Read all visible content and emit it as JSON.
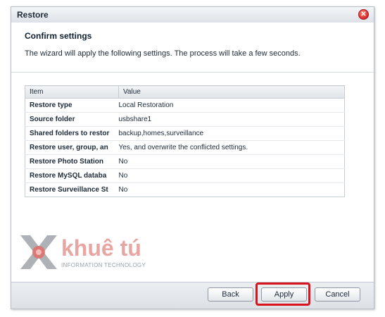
{
  "window": {
    "title": "Restore",
    "close_label": "✕"
  },
  "header": {
    "heading": "Confirm settings",
    "description": "The wizard will apply the following settings. The process will take a few seconds."
  },
  "table": {
    "columns": [
      "Item",
      "Value"
    ],
    "rows": [
      {
        "item": "Restore type",
        "value": "Local Restoration"
      },
      {
        "item": "Source folder",
        "value": "usbshare1"
      },
      {
        "item": "Shared folders to restor",
        "value": "backup,homes,surveillance"
      },
      {
        "item": "Restore user, group, an",
        "value": "Yes, and overwrite the conflicted settings."
      },
      {
        "item": "Restore Photo Station",
        "value": "No"
      },
      {
        "item": "Restore MySQL databa",
        "value": "No"
      },
      {
        "item": "Restore Surveillance St",
        "value": "No"
      }
    ]
  },
  "footer": {
    "back_label": "Back",
    "apply_label": "Apply",
    "cancel_label": "Cancel"
  },
  "watermark": {
    "brand": "khuê tú",
    "tagline": "INFORMATION TECHNOLOGY"
  },
  "colors": {
    "highlight": "#d9141c",
    "close_button": "#d9262a"
  },
  "icons": [
    "close-icon",
    "watermark-logo-icon"
  ]
}
